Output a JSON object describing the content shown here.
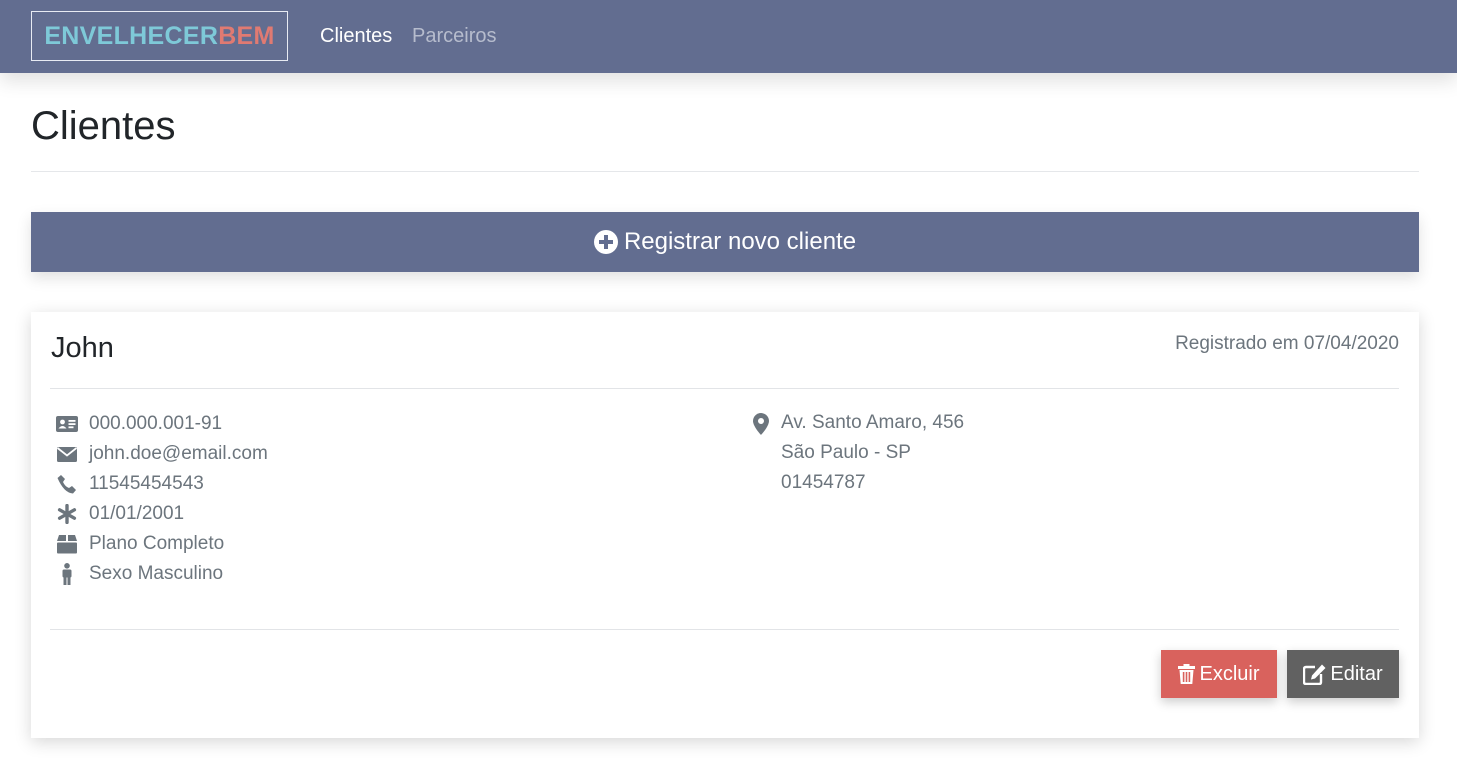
{
  "navbar": {
    "brand_part1": "ENVELHECER",
    "brand_part2": "BEM",
    "links": [
      {
        "label": "Clientes",
        "active": true
      },
      {
        "label": "Parceiros",
        "active": false
      }
    ]
  },
  "page": {
    "title": "Clientes",
    "register_button_label": "Registrar novo cliente",
    "register_button_icon": "plus-circle-icon"
  },
  "client": {
    "name": "John",
    "registered": "Registrado em 07/04/2020",
    "details": [
      {
        "icon": "id-card-icon",
        "text": "000.000.001-91"
      },
      {
        "icon": "envelope-icon",
        "text": "john.doe@email.com"
      },
      {
        "icon": "phone-icon",
        "text": "11545454543"
      },
      {
        "icon": "asterisk-icon",
        "text": "01/01/2001"
      },
      {
        "icon": "box-icon",
        "text": "Plano Completo"
      },
      {
        "icon": "male-icon",
        "text": "Sexo Masculino"
      }
    ],
    "address": {
      "icon": "map-marker-icon",
      "lines": [
        "Av. Santo Amaro, 456",
        "São Paulo - SP",
        "01454787"
      ]
    },
    "actions": {
      "delete_label": "Excluir",
      "edit_label": "Editar"
    }
  },
  "colors": {
    "navbar": "#626d90",
    "brand_part1": "#7ec9d8",
    "brand_part2": "#e07a72",
    "delete_button": "#d9625d",
    "edit_button": "#616161",
    "muted_text": "#6c757d"
  }
}
